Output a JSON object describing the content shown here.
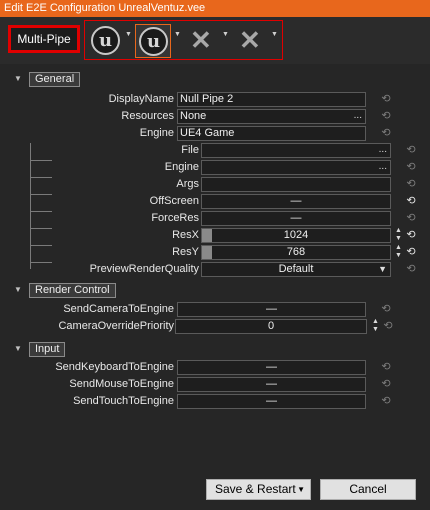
{
  "window": {
    "title": "Edit E2E Configuration UnrealVentuz.vee"
  },
  "toolbar": {
    "multi_pipe_label": "Multi-Pipe",
    "pipes": [
      {
        "icon": "unreal-logo-icon",
        "logo_letter": "u",
        "selected": false
      },
      {
        "icon": "unreal-logo-icon",
        "logo_letter": "u",
        "selected": true
      },
      {
        "icon": "close-x-icon",
        "symbol": "✕",
        "selected": false
      },
      {
        "icon": "close-x-icon",
        "symbol": "✕",
        "selected": false
      }
    ]
  },
  "sections": {
    "general": {
      "label": "General",
      "display_name": {
        "label": "DisplayName",
        "value": "Null Pipe 2"
      },
      "resources": {
        "label": "Resources",
        "value": "None",
        "browse": "..."
      },
      "engine": {
        "label": "Engine",
        "value": "UE4 Game"
      },
      "children": {
        "file": {
          "label": "File",
          "value": "",
          "browse": "..."
        },
        "engine": {
          "label": "Engine",
          "value": "",
          "browse": "..."
        },
        "args": {
          "label": "Args",
          "value": ""
        },
        "offscreen": {
          "label": "OffScreen",
          "value": "—"
        },
        "forceres": {
          "label": "ForceRes",
          "value": "—"
        },
        "resx": {
          "label": "ResX",
          "value": "1024"
        },
        "resy": {
          "label": "ResY",
          "value": "768"
        },
        "preview_render_quality": {
          "label": "PreviewRenderQuality",
          "value": "Default"
        }
      }
    },
    "render_control": {
      "label": "Render Control",
      "send_camera": {
        "label": "SendCameraToEngine",
        "value": "—"
      },
      "camera_override": {
        "label": "CameraOverridePriority",
        "value": "0"
      }
    },
    "input": {
      "label": "Input",
      "send_keyboard": {
        "label": "SendKeyboardToEngine",
        "value": "—"
      },
      "send_mouse": {
        "label": "SendMouseToEngine",
        "value": "—"
      },
      "send_touch": {
        "label": "SendTouchToEngine",
        "value": "—"
      }
    }
  },
  "glyphs": {
    "reset": "⟲",
    "expanded": "▼",
    "spin_up": "▲",
    "spin_down": "▼",
    "dropdown": "▼"
  },
  "footer": {
    "save_restart_label": "Save & Restart",
    "save_arrow": "▼",
    "cancel_label": "Cancel"
  },
  "colors": {
    "title_bar": "#e8671c",
    "highlight_border": "#e00000",
    "background": "#2b2b2b"
  }
}
